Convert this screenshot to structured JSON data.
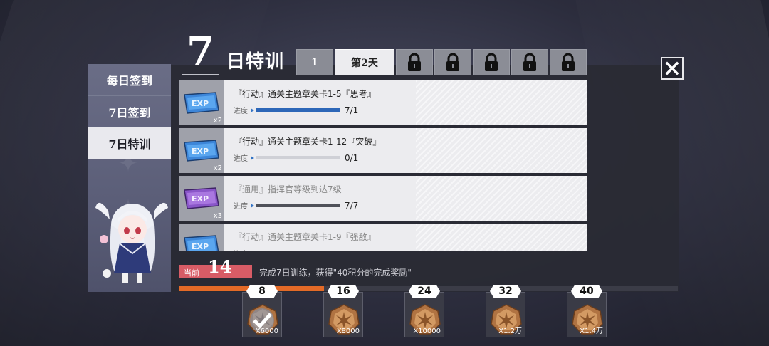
{
  "header": {
    "big_number": "7",
    "title": "日特训",
    "day_tabs": [
      {
        "label": "1",
        "state": "normal"
      },
      {
        "label": "第2天",
        "state": "active"
      },
      {
        "label": "",
        "state": "locked"
      },
      {
        "label": "",
        "state": "locked"
      },
      {
        "label": "",
        "state": "locked"
      },
      {
        "label": "",
        "state": "locked"
      },
      {
        "label": "",
        "state": "locked"
      }
    ],
    "close_icon": "close-x-icon"
  },
  "sidebar": {
    "items": [
      {
        "label": "每日签到",
        "selected": false
      },
      {
        "label": "7日签到",
        "selected": false
      },
      {
        "label": "7日特训",
        "selected": true
      }
    ]
  },
  "quests": [
    {
      "title": "『行动』通关主题章关卡1-5『思考』",
      "progress_label": "进度",
      "progress_value": "7/1",
      "progress_fraction": 1.0,
      "reward_icon": "exp-card-blue-icon",
      "reward_qty": "x2",
      "done": false
    },
    {
      "title": "『行动』通关主题章关卡1-12『突破』",
      "progress_label": "进度",
      "progress_value": "0/1",
      "progress_fraction": 0.0,
      "reward_icon": "exp-card-blue-icon",
      "reward_qty": "x2",
      "done": false
    },
    {
      "title": "『通用』指挥官等级到达7级",
      "progress_label": "进度",
      "progress_value": "7/7",
      "progress_fraction": 1.0,
      "reward_icon": "exp-card-purple-icon",
      "reward_qty": "x3",
      "done": true
    },
    {
      "title": "『行动』通关主题章关卡1-9『强敌』",
      "progress_label": "进度",
      "progress_value": "",
      "progress_fraction": 0.0,
      "reward_icon": "exp-card-blue-icon",
      "reward_qty": "",
      "done": true
    }
  ],
  "score": {
    "current_label": "当前",
    "current_value": "14",
    "goal_text": "完成7日训练，获得\"40积分的完成奖励\"",
    "fill_fraction": 0.29
  },
  "milestones": [
    {
      "points": "8",
      "qty": "X6000",
      "icon": "gold-medal-icon",
      "claimed": true
    },
    {
      "points": "16",
      "qty": "X8000",
      "icon": "gold-medal-icon",
      "claimed": false
    },
    {
      "points": "24",
      "qty": "X10000",
      "icon": "gold-medal-icon",
      "claimed": false
    },
    {
      "points": "32",
      "qty": "X1.2万",
      "icon": "gold-medal-icon",
      "claimed": false
    },
    {
      "points": "40",
      "qty": "X1.4万",
      "icon": "gold-medal-icon",
      "claimed": false
    }
  ],
  "colors": {
    "accent_orange": "#e36a27",
    "progress_blue": "#2d67b8",
    "current_red": "#d85c66",
    "exp_blue": "#3d86d9",
    "exp_purple": "#8a56c9"
  }
}
